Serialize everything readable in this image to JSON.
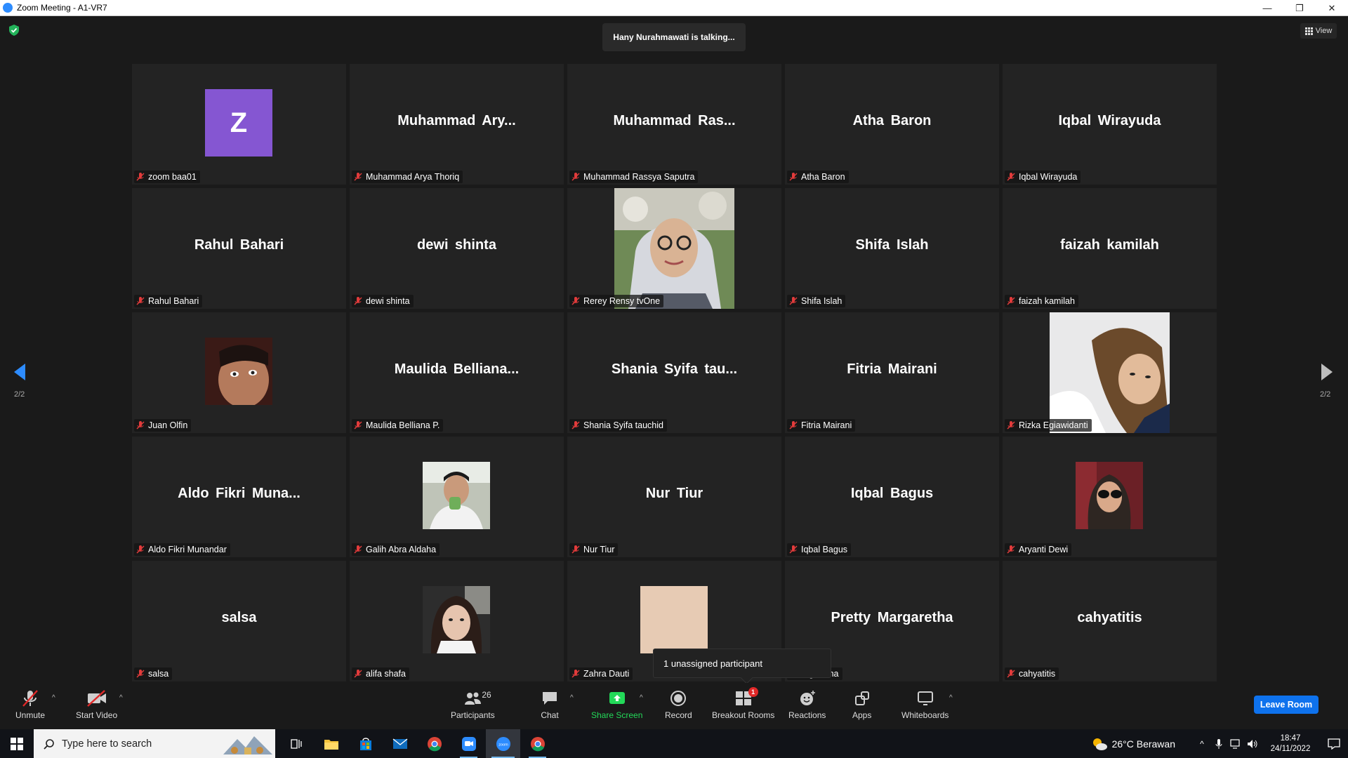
{
  "window": {
    "title": "Zoom Meeting - A1-VR7",
    "minimize": "—",
    "restore": "❐",
    "close": "✕"
  },
  "header": {
    "talking": "Hany Nurahmawati is talking...",
    "view_label": "View"
  },
  "pager": {
    "left_label": "2/2",
    "right_label": "2/2"
  },
  "tiles": [
    {
      "tag": "zoom baa01",
      "avatar_letter": "Z"
    },
    {
      "tag": "Muhammad Arya Thoriq",
      "big": "Muhammad  Ary..."
    },
    {
      "tag": "Muhammad Rassya Saputra",
      "big": "Muhammad  Ras..."
    },
    {
      "tag": "Atha Baron",
      "big": "Atha Baron"
    },
    {
      "tag": "Iqbal Wirayuda",
      "big": "Iqbal Wirayuda"
    },
    {
      "tag": "Rahul Bahari",
      "big": "Rahul Bahari"
    },
    {
      "tag": "dewi shinta",
      "big": "dewi shinta"
    },
    {
      "tag": "Rerey Rensy tvOne"
    },
    {
      "tag": "Shifa Islah",
      "big": "Shifa Islah"
    },
    {
      "tag": "faizah kamilah",
      "big": "faizah kamilah"
    },
    {
      "tag": "Juan Olfin"
    },
    {
      "tag": "Maulida Belliana P.",
      "big": "Maulida  Belliana..."
    },
    {
      "tag": "Shania Syifa tauchid",
      "big": "Shania  Syifa  tau..."
    },
    {
      "tag": "Fitria Mairani",
      "big": "Fitria Mairani"
    },
    {
      "tag": "Rizka Egiawidanti"
    },
    {
      "tag": "Aldo Fikri Munandar",
      "big": "Aldo  Fikri  Muna..."
    },
    {
      "tag": "Galih Abra Aldaha"
    },
    {
      "tag": "Nur Tiur",
      "big": "Nur Tiur"
    },
    {
      "tag": "Iqbal Bagus",
      "big": "Iqbal Bagus"
    },
    {
      "tag": "Aryanti Dewi"
    },
    {
      "tag": "salsa",
      "big": "salsa"
    },
    {
      "tag": "alifa shafa"
    },
    {
      "tag": "Zahra Dauti"
    },
    {
      "tag": "Pretty Margaretha",
      "tag_visible": "argaretha",
      "big": "Pretty Margaretha"
    },
    {
      "tag": "cahyatitis",
      "big": "cahyatitis"
    }
  ],
  "popup": {
    "unassigned": "1 unassigned participant"
  },
  "toolbar": {
    "unmute": "Unmute",
    "start_video": "Start Video",
    "participants": "Participants",
    "participants_count": "26",
    "chat": "Chat",
    "share_screen": "Share Screen",
    "record": "Record",
    "breakout_rooms": "Breakout Rooms",
    "breakout_badge": "1",
    "reactions": "Reactions",
    "apps": "Apps",
    "whiteboards": "Whiteboards",
    "leave": "Leave Room",
    "share_color": "#23d959",
    "leave_color": "#0e72ed"
  },
  "taskbar": {
    "search_placeholder": "Type here to search",
    "weather": "26°C  Berawan",
    "time": "18:47",
    "date": "24/11/2022"
  }
}
